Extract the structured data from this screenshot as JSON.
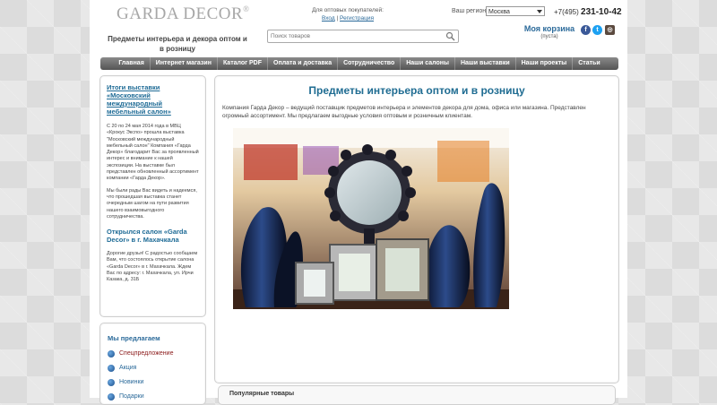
{
  "header": {
    "logo": "GARDA DECOR",
    "logo_mark": "®",
    "tagline": "Предметы интерьера и декора оптом и в розницу",
    "wholesale_label": "Для оптовых покупателей:",
    "login": "Вход",
    "separator": "|",
    "register": "Регистрация",
    "search_placeholder": "Поиск товаров",
    "region_label": "Ваш регион:",
    "region_value": "Москва",
    "phone_code": "+7(495)",
    "phone_number": "231-10-42",
    "cart_title": "Моя корзина",
    "cart_status": "(пуста)",
    "social": [
      {
        "name": "facebook-icon",
        "glyph": "f",
        "color": "#3b5998"
      },
      {
        "name": "twitter-icon",
        "glyph": "t",
        "color": "#1da1f2"
      },
      {
        "name": "instagram-icon",
        "glyph": "◎",
        "color": "#5b4a3f"
      }
    ]
  },
  "nav": [
    "Главная",
    "Интернет магазин",
    "Каталог PDF",
    "Оплата и доставка",
    "Сотрудничество",
    "Наши салоны",
    "Наши выставки",
    "Наши проекты",
    "Статьи"
  ],
  "sidebar": {
    "news": [
      {
        "title": "Итоги выставки «Московский международный мебельный салон»",
        "paragraphs": [
          "С 20 по 24 мая 2014 года в МВЦ «Крокус Экспо» прошла выставка \"Московский международный мебельный салон\" Компания «Гарда Декор» благодарит Вас за проявленный интерес и внимание к нашей экспозиции. На выставке был представлен обновленный ассортимент компании «Гарда Декор».",
          "Мы были рады Вас видеть и надеемся, что прошедшая выставка станет очередным шагом на пути развития нашего взаимовыгодного сотрудничества."
        ]
      },
      {
        "title": "Открылся салон «Garda Decor» в г. Махачкала",
        "paragraphs": [
          "Дорогие друзья! С радостью сообщаем Вам, что состоялось открытие салона «Garda Decor» в г. Махачкала. Ждем Вас по адресу: г. Махачкала, ул. Ирчи Казака, д. 31Б"
        ]
      }
    ],
    "offer_title": "Мы предлагаем",
    "offers": [
      {
        "label": "Спецпредложение",
        "color": "#8b1a1a"
      },
      {
        "label": "Акция",
        "color": "#2b6a9a"
      },
      {
        "label": "Новинки",
        "color": "#2b6a9a"
      },
      {
        "label": "Подарки",
        "color": "#2b6a9a"
      }
    ]
  },
  "main": {
    "title": "Предметы интерьера оптом и в розницу",
    "description": "Компания Гарда Декор – ведущий поставщик предметов интерьера и элементов декора для дома, офиса или магазина. Представлен огромный ассортимент. Мы предлагаем выгодные условия оптовым и розничным клиентам."
  },
  "popular": {
    "title": "Популярные товары"
  }
}
